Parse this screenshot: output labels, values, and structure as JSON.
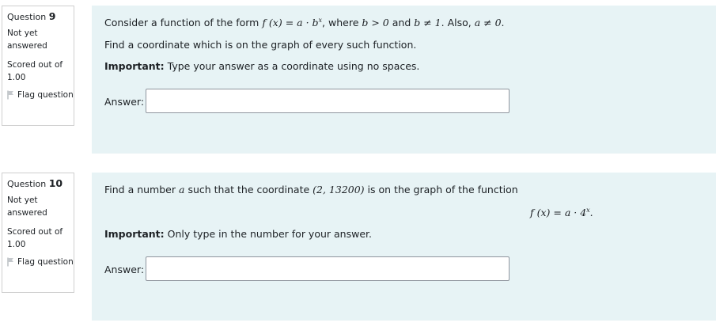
{
  "questions": [
    {
      "label": "Question",
      "number": "9",
      "state": "Not yet answered",
      "grade": "Scored out of 1.00",
      "flag_label": "Flag question",
      "text_intro": "Consider a function of the form",
      "fx": "f (x) = a · b",
      "fx_exp": "x",
      "text_where": ", where",
      "cond1": "b > 0",
      "text_and": "and",
      "cond2": "b ≠ 1",
      "text_also": ". Also,",
      "cond3": "a ≠ 0",
      "end": ".",
      "line2": "Find a coordinate which is on the graph of every such function.",
      "important_label": "Important:",
      "important_text": "Type your answer as a coordinate using no spaces.",
      "answer_label": "Answer:",
      "answer_value": ""
    },
    {
      "label": "Question",
      "number": "10",
      "state": "Not yet answered",
      "grade": "Scored out of 1.00",
      "flag_label": "Flag question",
      "text1": "Find a number",
      "var_a": "a",
      "text2": "such that the coordinate",
      "coord": "(2, 13200)",
      "text3": "is on the graph of the function",
      "fx": "f (x) = a · 4",
      "fx_exp": "x",
      "fx_end": ".",
      "important_label": "Important:",
      "important_text": "Only type in the number for your answer.",
      "answer_label": "Answer:",
      "answer_value": ""
    }
  ],
  "colors": {
    "content_bg": "#e7f3f5",
    "info_border": "#cfcfcf",
    "input_border": "#8f959e"
  }
}
